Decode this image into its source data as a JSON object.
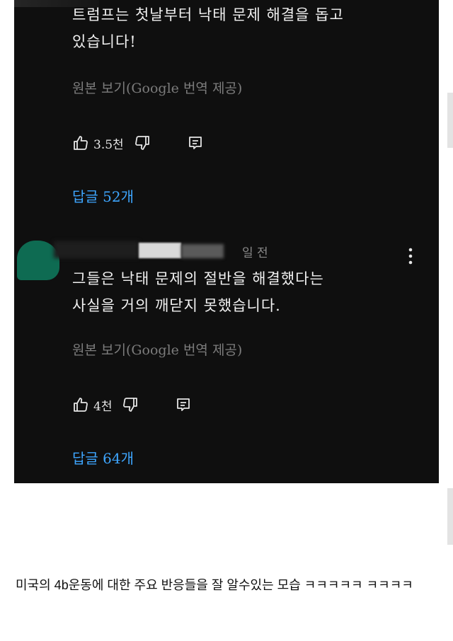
{
  "comments": [
    {
      "text_lines": [
        "트럼프는 첫날부터 낙태 문제 해결을 돕고",
        "있습니다!"
      ],
      "translate_label": "원본 보기(Google 번역 제공)",
      "like_count": "3.5천",
      "replies_label": "답글 52개"
    },
    {
      "time": "일 전",
      "text_lines": [
        "그들은 낙태 문제의 절반을 해결했다는",
        "사실을 거의 깨닫지 못했습니다."
      ],
      "translate_label": "원본 보기(Google 번역 제공)",
      "like_count": "4천",
      "replies_label": "답글 64개"
    }
  ],
  "caption": "미국의 4b운동에 대한 주요 반응들을 잘 알수있는 모습 ㅋㅋㅋㅋㅋ ㅋㅋㅋㅋ",
  "colors": {
    "background": "#0f0f0f",
    "text": "#f1f1f1",
    "secondary_text": "#7c7c7c",
    "link": "#3ea6ff",
    "avatar": "#0e6b52"
  },
  "icons": [
    "thumbs-up-icon",
    "thumbs-down-icon",
    "reply-icon",
    "more-vert-icon"
  ]
}
